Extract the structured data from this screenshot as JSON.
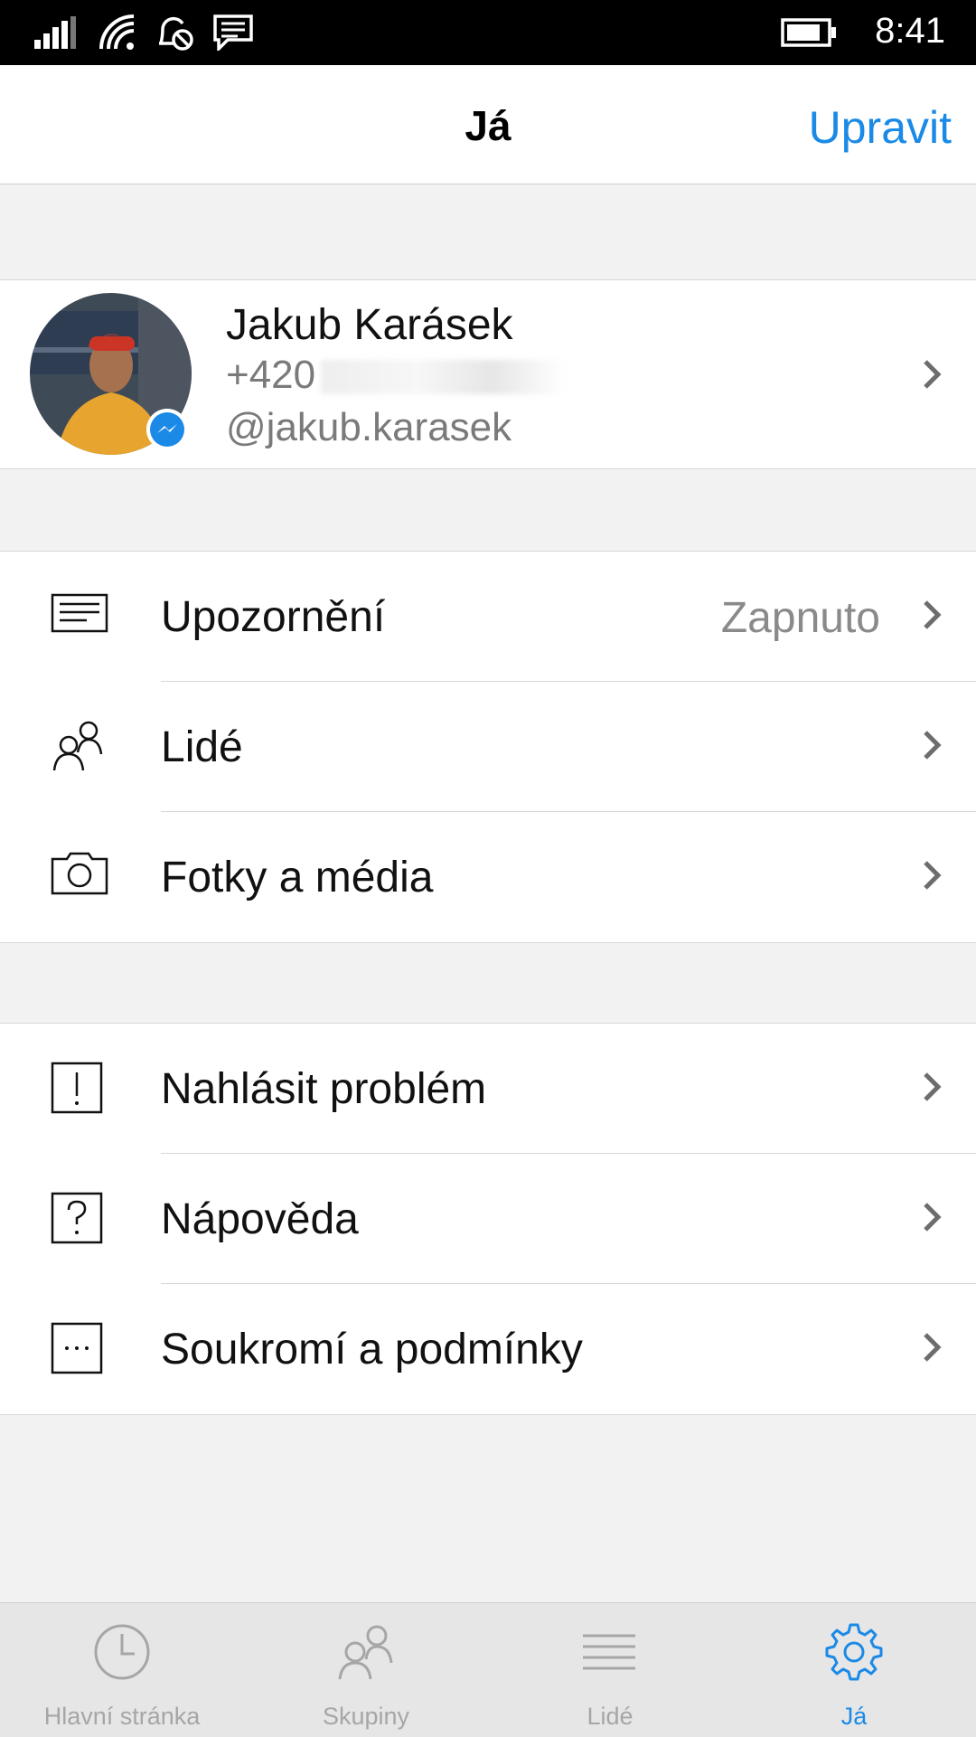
{
  "status_bar": {
    "time": "8:41",
    "icons": [
      "signal-icon",
      "wifi-icon",
      "quiet-hours-icon",
      "message-icon",
      "battery-icon"
    ]
  },
  "header": {
    "title": "Já",
    "edit_label": "Upravit"
  },
  "profile": {
    "name": "Jakub Karásek",
    "phone_visible": "+420",
    "username": "@jakub.karasek"
  },
  "settings_group_1": [
    {
      "icon": "notification-icon",
      "label": "Upozornění",
      "value": "Zapnuto"
    },
    {
      "icon": "people-icon",
      "label": "Lidé"
    },
    {
      "icon": "camera-icon",
      "label": "Fotky a média"
    }
  ],
  "settings_group_2": [
    {
      "icon": "report-problem-icon",
      "label": "Nahlásit problém"
    },
    {
      "icon": "help-icon",
      "label": "Nápověda"
    },
    {
      "icon": "privacy-icon",
      "label": "Soukromí a podmínky"
    }
  ],
  "bottom_nav": [
    {
      "icon": "clock-icon",
      "label": "Hlavní stránka"
    },
    {
      "icon": "groups-icon",
      "label": "Skupiny"
    },
    {
      "icon": "list-icon",
      "label": "Lidé"
    },
    {
      "icon": "gear-icon",
      "label": "Já",
      "active": true
    }
  ],
  "colors": {
    "accent": "#1a8ae6",
    "background": "#f2f2f2"
  }
}
